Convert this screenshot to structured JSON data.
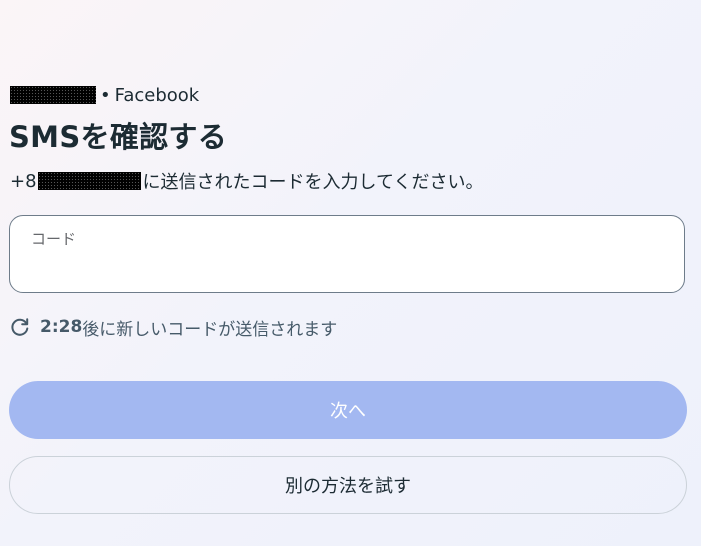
{
  "header": {
    "account_redacted": "",
    "separator": "•",
    "app_name": "Facebook"
  },
  "title": "SMSを確認する",
  "description": {
    "phone_prefix": "+8",
    "phone_redacted": "",
    "text": "に送信されたコードを入力してください。"
  },
  "code_field": {
    "label": "コード",
    "value": ""
  },
  "resend": {
    "icon": "refresh-icon",
    "timer": "2:28",
    "text": "後に新しいコードが送信されます"
  },
  "buttons": {
    "next_label": "次へ",
    "other_method_label": "別の方法を試す"
  },
  "colors": {
    "primary_disabled": "#a3b8f1",
    "text": "#1c2b33"
  }
}
